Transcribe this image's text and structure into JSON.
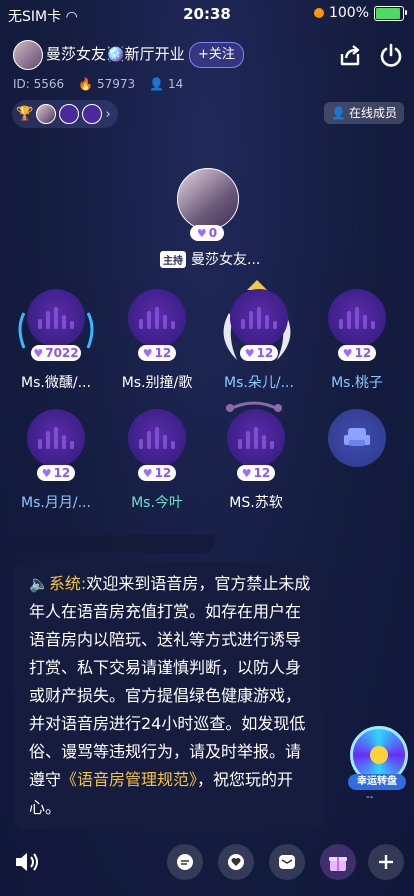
{
  "status_bar": {
    "carrier": "无SIM卡",
    "time": "20:38",
    "battery": "100%",
    "battery_level": 1.0
  },
  "room": {
    "title": "曼莎女友🪩新厅开业",
    "follow_label": "+关注",
    "id_text": "ID: 5566",
    "heat": "57973",
    "members": "14",
    "online_label": "在线成员"
  },
  "host": {
    "tag": "主持",
    "name": "曼莎女友...",
    "count": "0"
  },
  "seats": [
    {
      "name": "Ms.微醺/...",
      "count": "7022",
      "name_color": "#ffffff"
    },
    {
      "name": "Ms.别撞/歌",
      "count": "12",
      "name_color": "#ffffff"
    },
    {
      "name": "Ms.朵儿/...",
      "count": "12",
      "name_color": "#8fc7ff"
    },
    {
      "name": "Ms.桃子",
      "count": "12",
      "name_color": "#8fc7ff"
    },
    {
      "name": "Ms.月月/...",
      "count": "12",
      "name_color": "#8fc7ff"
    },
    {
      "name": "Ms.今叶",
      "count": "12",
      "name_color": "#6fe0c7"
    },
    {
      "name": "MS.苏软",
      "count": "12",
      "name_color": "#ffffff"
    }
  ],
  "system_message": {
    "label": "系统:",
    "body": "欢迎来到语音房，官方禁止未成年人在语音房充值打赏。如存在用户在语音房内以陪玩、送礼等方式进行诱导打赏、私下交易请谨慎判断，以防人身或财产损失。官方提倡绿色健康游戏，并对语音房进行24小时巡查。如发现低俗、谩骂等违规行为，请及时举报。请遵守",
    "link": "《语音房管理规范》",
    "tail": "，祝您玩的开心。"
  },
  "wheel": {
    "label": "幸运转盘",
    "dots": "--"
  },
  "colors": {
    "background": "#141c3f",
    "accent": "#8a54ff",
    "link": "#f5c542"
  }
}
